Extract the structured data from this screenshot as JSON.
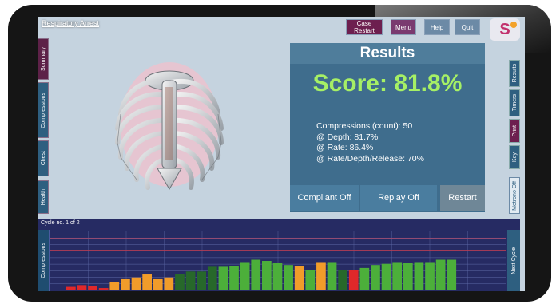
{
  "header": {
    "scenario_title": "Respiratory Arrest",
    "case_restart_label": "Case\nRestart",
    "menu_label": "Menu",
    "help_label": "Help",
    "quit_label": "Quit",
    "logo_letter": "S"
  },
  "left_tabs": [
    {
      "label": "Summary",
      "color": "purple"
    },
    {
      "label": "Compressions",
      "color": "blue"
    },
    {
      "label": "Chest",
      "color": "blue"
    },
    {
      "label": "Health",
      "color": "blue"
    }
  ],
  "right_tabs": [
    {
      "label": "Results",
      "color": "blue"
    },
    {
      "label": "Timers",
      "color": "blue"
    },
    {
      "label": "Print",
      "color": "purple"
    },
    {
      "label": "Key",
      "color": "blue"
    },
    {
      "label": "Metrono Off",
      "color": "light"
    }
  ],
  "results": {
    "title": "Results",
    "score": "Score: 81.8%",
    "compressions_count": "Compressions (count): 50",
    "depth": "@ Depth: 81.7%",
    "rate": "@ Rate: 86.4%",
    "rate_depth_release": "@ Rate/Depth/Release: 70%",
    "compliant_label": "Compliant Off",
    "replay_label": "Replay Off",
    "restart_label": "Restart"
  },
  "chart_panel": {
    "cycle_label": "Cycle no. 1 of 2",
    "y_tab_label": "Compressions",
    "next_tab_label": "Next Cycle"
  },
  "colors": {
    "green": "#4caf3a",
    "dark_green": "#27682a",
    "orange": "#f19c2a",
    "red": "#e0282a",
    "reference_line": "#b43c55",
    "grid": "#5f6aa8"
  },
  "chart_data": {
    "type": "bar",
    "title": "",
    "xlabel": "",
    "ylabel": "Compressions",
    "ylim": [
      0,
      1
    ],
    "reference_lines": [
      0.88,
      0.68
    ],
    "values": [
      0.06,
      0.09,
      0.07,
      0.04,
      0.14,
      0.19,
      0.22,
      0.27,
      0.19,
      0.22,
      0.28,
      0.32,
      0.32,
      0.4,
      0.4,
      0.41,
      0.48,
      0.52,
      0.5,
      0.46,
      0.43,
      0.41,
      0.35,
      0.48,
      0.48,
      0.34,
      0.35,
      0.38,
      0.43,
      0.45,
      0.48,
      0.47,
      0.48,
      0.48,
      0.52,
      0.52
    ],
    "bar_colors": [
      "red",
      "red",
      "red",
      "red",
      "orange",
      "orange",
      "orange",
      "orange",
      "orange",
      "orange",
      "dark_green",
      "dark_green",
      "dark_green",
      "dark_green",
      "green",
      "green",
      "green",
      "green",
      "green",
      "green",
      "green",
      "orange",
      "green",
      "orange",
      "green",
      "dark_green",
      "red",
      "green",
      "green",
      "green",
      "green",
      "green",
      "green",
      "green",
      "green",
      "green"
    ]
  }
}
